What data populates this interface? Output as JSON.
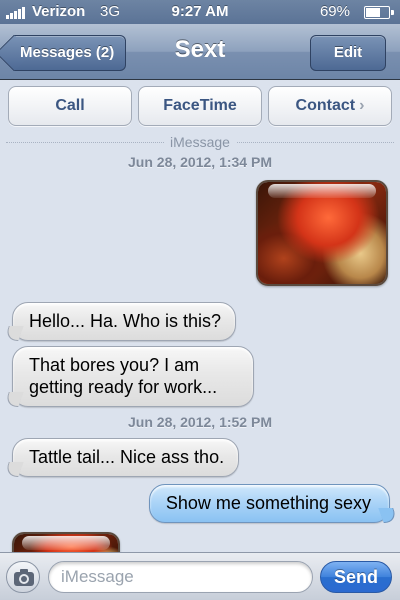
{
  "status_bar": {
    "carrier": "Verizon",
    "network": "3G",
    "time": "9:27 AM",
    "battery_percent": "69%",
    "battery_level": 0.69,
    "signal_bars": 5
  },
  "nav_bar": {
    "back_label": "Messages (2)",
    "title": "Sext",
    "edit_label": "Edit"
  },
  "actions": {
    "call": "Call",
    "facetime": "FaceTime",
    "contact": "Contact"
  },
  "conversation": {
    "service": "iMessage",
    "timestamps": [
      "Jun 28, 2012, 1:34 PM",
      "Jun 28, 2012, 1:52 PM"
    ],
    "messages": [
      {
        "direction": "outgoing",
        "kind": "photo"
      },
      {
        "direction": "incoming",
        "kind": "text",
        "text": "Hello... Ha. Who is this?"
      },
      {
        "direction": "incoming",
        "kind": "text",
        "text": "That bores you? I am getting ready for work..."
      },
      {
        "direction": "incoming",
        "kind": "text",
        "text": "Tattle tail... Nice ass tho."
      },
      {
        "direction": "outgoing",
        "kind": "text",
        "text": "Show me something sexy"
      },
      {
        "direction": "incoming",
        "kind": "photo"
      }
    ]
  },
  "input_bar": {
    "placeholder": "iMessage",
    "value": "",
    "send_label": "Send",
    "camera_icon": "camera-icon"
  },
  "colors": {
    "nav_blue": "#6d85a7",
    "background": "#dbe2ed",
    "incoming_bubble": "#e8e8e8",
    "outgoing_bubble": "#a9d3f7",
    "send_button": "#3f82dc"
  }
}
